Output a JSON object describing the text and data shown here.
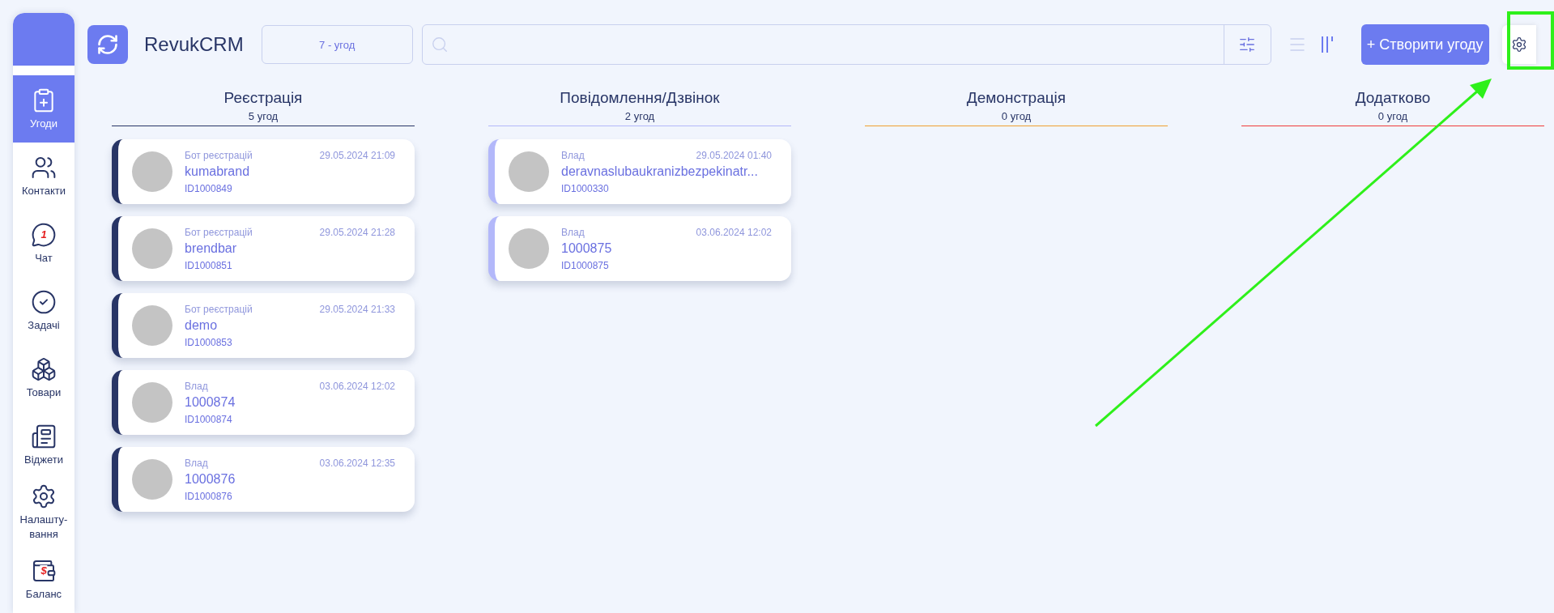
{
  "sidebar": {
    "items": [
      {
        "label": "Угоди",
        "selected": true
      },
      {
        "label": "Контакти",
        "selected": false
      },
      {
        "label": "Чат",
        "selected": false,
        "badge": "1"
      },
      {
        "label": "Задачі",
        "selected": false
      },
      {
        "label": "Товари",
        "selected": false
      },
      {
        "label": "Віджети",
        "selected": false
      },
      {
        "label": "Налашту-вання",
        "selected": false
      },
      {
        "label": "Баланс",
        "selected": false,
        "badge": "$"
      }
    ]
  },
  "header": {
    "app_name": "RevukCRM",
    "deal_count": "7 - угод",
    "create_button": "+ Створити угоду",
    "views": [
      {
        "kind": "list",
        "selected": false
      },
      {
        "kind": "kanban",
        "selected": true
      }
    ]
  },
  "columns": [
    {
      "title": "Реєстрація",
      "count": "5 угод",
      "color": "#283566",
      "cards": [
        {
          "author": "Бот реєстрацій",
          "date": "29.05.2024 21:09",
          "name": "kumabrand",
          "id": "ID1000849"
        },
        {
          "author": "Бот реєстрацій",
          "date": "29.05.2024 21:28",
          "name": "brendbar",
          "id": "ID1000851"
        },
        {
          "author": "Бот реєстрацій",
          "date": "29.05.2024 21:33",
          "name": "demo",
          "id": "ID1000853"
        },
        {
          "author": "Влад",
          "date": "03.06.2024 12:02",
          "name": "1000874",
          "id": "ID1000874"
        },
        {
          "author": "Влад",
          "date": "03.06.2024 12:35",
          "name": "1000876",
          "id": "ID1000876"
        }
      ]
    },
    {
      "title": "Повідомлення/Дзвінок",
      "count": "2 угод",
      "color": "#b3b8fa",
      "cards": [
        {
          "author": "Влад",
          "date": "29.05.2024 01:40",
          "name": "deravnaslubaukranizbezpekinatr...",
          "id": "ID1000330"
        },
        {
          "author": "Влад",
          "date": "03.06.2024 12:02",
          "name": "1000875",
          "id": "ID1000875"
        }
      ]
    },
    {
      "title": "Демонстрація",
      "count": "0 угод",
      "color": "#f0a030"
    },
    {
      "title": "Додатково",
      "count": "0 угод",
      "color": "#f03a3a"
    }
  ]
}
